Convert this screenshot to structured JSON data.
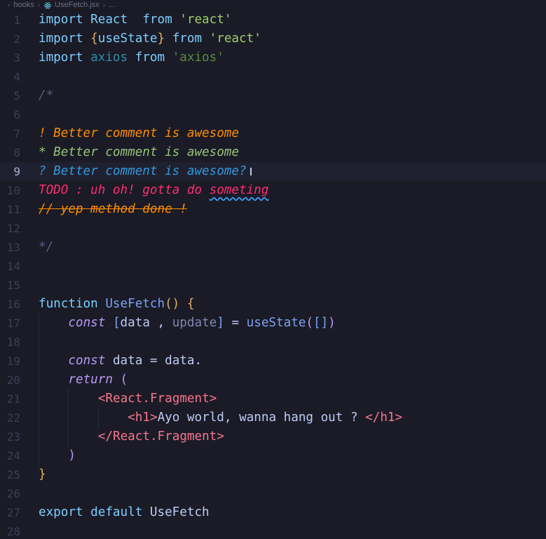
{
  "breadcrumb": {
    "folder": "hooks",
    "file": "UseFetch.jsx",
    "ellipsis": "..."
  },
  "editor": {
    "active_line": 9,
    "lines": [
      {
        "n": "1",
        "tokens": [
          [
            "kw-imp",
            "import"
          ],
          [
            "plain",
            " "
          ],
          [
            "ident",
            "React"
          ],
          [
            "plain",
            "  "
          ],
          [
            "kw-from",
            "from"
          ],
          [
            "plain",
            " "
          ],
          [
            "str",
            "'react'"
          ]
        ]
      },
      {
        "n": "2",
        "tokens": [
          [
            "kw-imp",
            "import"
          ],
          [
            "plain",
            " "
          ],
          [
            "brace",
            "{"
          ],
          [
            "ident",
            "useState"
          ],
          [
            "brace",
            "}"
          ],
          [
            "plain",
            " "
          ],
          [
            "kw-from",
            "from"
          ],
          [
            "plain",
            " "
          ],
          [
            "str",
            "'react'"
          ]
        ]
      },
      {
        "n": "3",
        "tokens": [
          [
            "kw-imp",
            "import"
          ],
          [
            "plain",
            " "
          ],
          [
            "ident-dim",
            "axios"
          ],
          [
            "plain",
            " "
          ],
          [
            "kw-from",
            "from"
          ],
          [
            "plain",
            " "
          ],
          [
            "str-dim",
            "'axios'"
          ]
        ]
      },
      {
        "n": "4",
        "tokens": []
      },
      {
        "n": "5",
        "tokens": [
          [
            "comment-dim",
            "/*"
          ]
        ]
      },
      {
        "n": "6",
        "tokens": []
      },
      {
        "n": "7",
        "tokens": [
          [
            "c-alert",
            "! Better comment is awesome"
          ]
        ]
      },
      {
        "n": "8",
        "tokens": [
          [
            "c-highlight",
            "* Better comment is awesome"
          ]
        ]
      },
      {
        "n": "9",
        "tokens": [
          [
            "c-query",
            "? Better comment is awesome?"
          ],
          [
            "caret",
            ""
          ]
        ]
      },
      {
        "n": "10",
        "tokens": [
          [
            "c-todo",
            "TODO : uh oh! gotta do "
          ],
          [
            "c-todo squiggle",
            "someting"
          ]
        ]
      },
      {
        "n": "11",
        "tokens": [
          [
            "c-strike",
            "// yep method done !"
          ]
        ]
      },
      {
        "n": "12",
        "tokens": []
      },
      {
        "n": "13",
        "tokens": [
          [
            "comment-dim",
            "*/"
          ]
        ]
      },
      {
        "n": "14",
        "tokens": []
      },
      {
        "n": "15",
        "tokens": []
      },
      {
        "n": "16",
        "tokens": [
          [
            "fn-kw",
            "function"
          ],
          [
            "plain",
            " "
          ],
          [
            "fn-name",
            "UseFetch"
          ],
          [
            "paren",
            "()"
          ],
          [
            "plain",
            " "
          ],
          [
            "paren",
            "{"
          ]
        ]
      },
      {
        "n": "17",
        "indent": 1,
        "tokens": [
          [
            "const-kw",
            "const"
          ],
          [
            "plain",
            " "
          ],
          [
            "bracket",
            "["
          ],
          [
            "var",
            "data"
          ],
          [
            "plain",
            " , "
          ],
          [
            "var-dim",
            "update"
          ],
          [
            "bracket",
            "]"
          ],
          [
            "plain",
            " = "
          ],
          [
            "fn-name",
            "useState"
          ],
          [
            "ret-paren",
            "("
          ],
          [
            "bracket",
            "[]"
          ],
          [
            "ret-paren",
            ")"
          ]
        ]
      },
      {
        "n": "18",
        "indent": 1,
        "tokens": []
      },
      {
        "n": "19",
        "indent": 1,
        "tokens": [
          [
            "const-kw",
            "const"
          ],
          [
            "plain",
            " "
          ],
          [
            "var",
            "data"
          ],
          [
            "plain",
            " = "
          ],
          [
            "var",
            "data."
          ]
        ]
      },
      {
        "n": "20",
        "indent": 1,
        "tokens": [
          [
            "ret",
            "return"
          ],
          [
            "plain",
            " "
          ],
          [
            "ret-paren",
            "("
          ]
        ]
      },
      {
        "n": "21",
        "indent": 2,
        "tokens": [
          [
            "tag",
            "<React.Fragment>"
          ]
        ]
      },
      {
        "n": "22",
        "indent": 3,
        "tokens": [
          [
            "tag",
            "<h1>"
          ],
          [
            "text",
            "Ayo world, wanna hang out ? "
          ],
          [
            "tag",
            "</h1>"
          ]
        ]
      },
      {
        "n": "23",
        "indent": 2,
        "tokens": [
          [
            "tag",
            "</React.Fragment>"
          ]
        ]
      },
      {
        "n": "24",
        "indent": 1,
        "tokens": [
          [
            "ret-paren",
            ")"
          ]
        ]
      },
      {
        "n": "25",
        "tokens": [
          [
            "paren",
            "}"
          ]
        ]
      },
      {
        "n": "26",
        "tokens": []
      },
      {
        "n": "27",
        "tokens": [
          [
            "exp",
            "export"
          ],
          [
            "plain",
            " "
          ],
          [
            "exp",
            "default"
          ],
          [
            "plain",
            " "
          ],
          [
            "usefetch",
            "UseFetch"
          ]
        ]
      },
      {
        "n": "28",
        "tokens": []
      }
    ]
  },
  "colors": {
    "background": "#1a1b26",
    "active_line": "#1f2130",
    "alert": "#ff8c00",
    "highlight": "#98c379",
    "query": "#3498db",
    "todo": "#ff2d6f"
  }
}
